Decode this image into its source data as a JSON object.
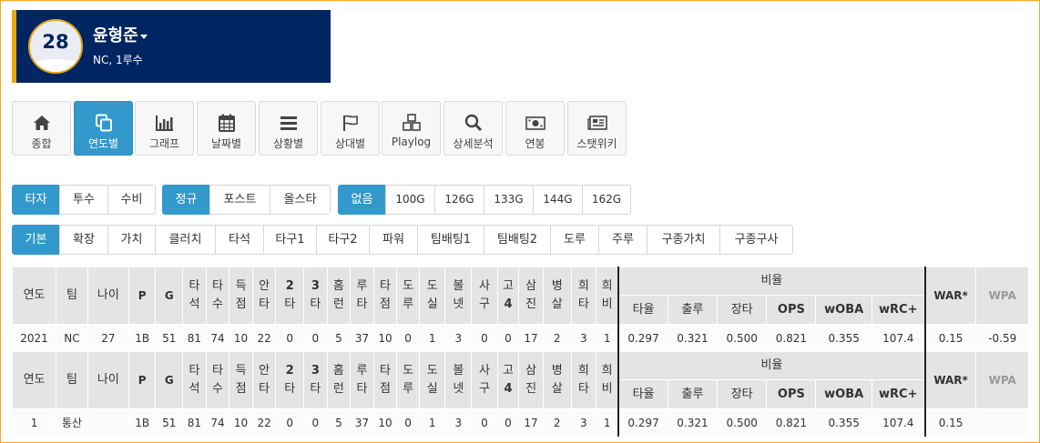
{
  "player": {
    "number": "28",
    "name": "윤형준",
    "team_position": "NC, 1루수"
  },
  "nav": [
    {
      "label": "종합",
      "icon": "home-icon",
      "active": false
    },
    {
      "label": "연도별",
      "icon": "copy-icon",
      "active": true
    },
    {
      "label": "그래프",
      "icon": "bar-chart-icon",
      "active": false
    },
    {
      "label": "날짜별",
      "icon": "calendar-icon",
      "active": false
    },
    {
      "label": "상황별",
      "icon": "list-icon",
      "active": false
    },
    {
      "label": "상대별",
      "icon": "flag-icon",
      "active": false
    },
    {
      "label": "Playlog",
      "icon": "cubes-icon",
      "active": false
    },
    {
      "label": "상세분석",
      "icon": "search-icon",
      "active": false
    },
    {
      "label": "연봉",
      "icon": "money-icon",
      "active": false
    },
    {
      "label": "스탯위키",
      "icon": "newspaper-icon",
      "active": false
    }
  ],
  "filters": {
    "role": [
      "타자",
      "투수",
      "수비"
    ],
    "season": [
      "정규",
      "포스트",
      "올스타"
    ],
    "scale": [
      "없음",
      "100G",
      "126G",
      "133G",
      "144G",
      "162G"
    ],
    "category": [
      "기본",
      "확장",
      "가치",
      "클러치",
      "타석",
      "타구1",
      "타구2",
      "파워",
      "팀배팅1",
      "팀배팅2",
      "도루",
      "주루",
      "구종가치",
      "구종구사"
    ]
  },
  "table": {
    "headers": [
      "연도",
      "팀",
      "나이",
      "P",
      "G",
      "타석",
      "타수",
      "득점",
      "안타",
      "2타",
      "3타",
      "홈런",
      "루타",
      "타점",
      "도루",
      "도실",
      "볼넷",
      "사구",
      "고4",
      "삼진",
      "병살",
      "희타",
      "희비"
    ],
    "ratio_header": "비율",
    "ratio_sub": [
      "타율",
      "출루",
      "장타",
      "OPS",
      "wOBA",
      "wRC+"
    ],
    "war_header": "WAR*",
    "wpa_header": "WPA",
    "row1": [
      "2021",
      "NC",
      "27",
      "1B",
      "51",
      "81",
      "74",
      "10",
      "22",
      "0",
      "0",
      "5",
      "37",
      "10",
      "0",
      "1",
      "3",
      "0",
      "0",
      "17",
      "2",
      "3",
      "1",
      "0.297",
      "0.321",
      "0.500",
      "0.821",
      "0.355",
      "107.4",
      "0.15",
      "-0.59"
    ],
    "row2": [
      "1",
      "통산",
      "",
      "1B",
      "51",
      "81",
      "74",
      "10",
      "22",
      "0",
      "0",
      "5",
      "37",
      "10",
      "0",
      "1",
      "3",
      "0",
      "0",
      "17",
      "2",
      "3",
      "1",
      "0.297",
      "0.321",
      "0.500",
      "0.821",
      "0.355",
      "107.4",
      "0.15",
      ""
    ]
  }
}
